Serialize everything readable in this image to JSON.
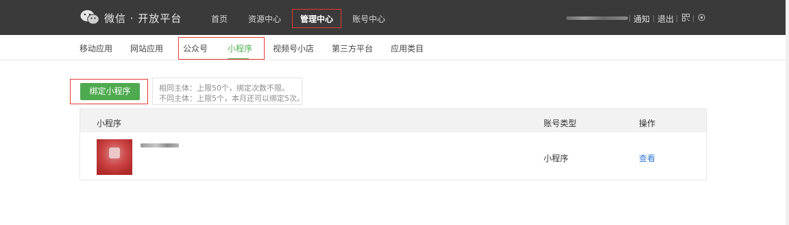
{
  "header": {
    "brand": "微信 · 开放平台",
    "nav": [
      {
        "label": "首页"
      },
      {
        "label": "资源中心"
      },
      {
        "label": "管理中心",
        "active": true
      },
      {
        "label": "账号中心"
      }
    ],
    "links": {
      "notify": "通知",
      "logout": "退出"
    }
  },
  "subnav": {
    "items": [
      {
        "label": "移动应用"
      },
      {
        "label": "网站应用"
      },
      {
        "label": "公众号"
      },
      {
        "label": "小程序",
        "active": true
      },
      {
        "label": "视频号小店"
      },
      {
        "label": "第三方平台"
      },
      {
        "label": "应用类目"
      }
    ]
  },
  "content": {
    "bind_button": "绑定小程序",
    "hint": {
      "line1": "相同主体：上限50个，绑定次数不限。",
      "line2": "不同主体：上限5个，本月还可以绑定5次。"
    },
    "table": {
      "columns": [
        "小程序",
        "账号类型",
        "操作"
      ],
      "rows": [
        {
          "type": "小程序",
          "action": "查看"
        }
      ]
    }
  },
  "colors": {
    "header_bg": "#3a3a3a",
    "accent_green": "#4eaa4e",
    "highlight_red": "#e53935",
    "link_blue": "#3a7bd5"
  }
}
